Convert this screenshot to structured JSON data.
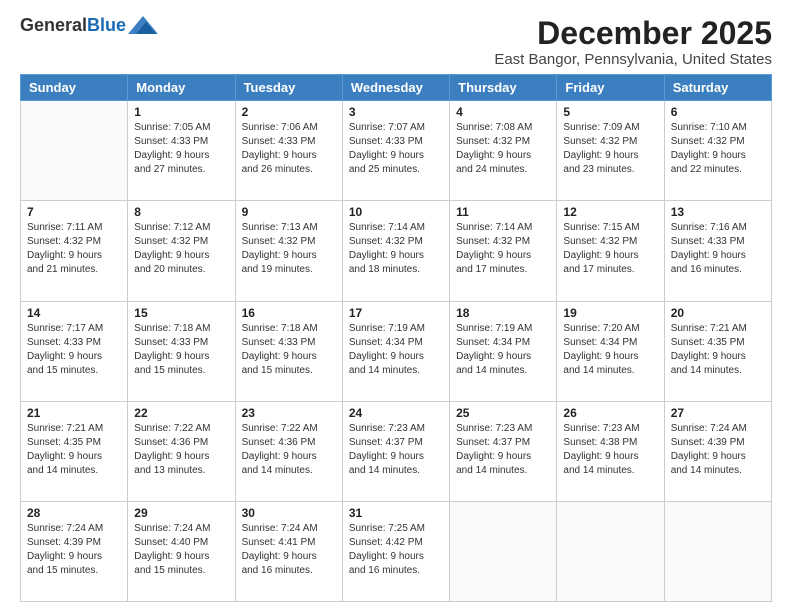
{
  "logo": {
    "general": "General",
    "blue": "Blue"
  },
  "title": "December 2025",
  "subtitle": "East Bangor, Pennsylvania, United States",
  "headers": [
    "Sunday",
    "Monday",
    "Tuesday",
    "Wednesday",
    "Thursday",
    "Friday",
    "Saturday"
  ],
  "weeks": [
    [
      {
        "day": "",
        "sunrise": "",
        "sunset": "",
        "daylight": ""
      },
      {
        "day": "1",
        "sunrise": "Sunrise: 7:05 AM",
        "sunset": "Sunset: 4:33 PM",
        "daylight": "Daylight: 9 hours and 27 minutes."
      },
      {
        "day": "2",
        "sunrise": "Sunrise: 7:06 AM",
        "sunset": "Sunset: 4:33 PM",
        "daylight": "Daylight: 9 hours and 26 minutes."
      },
      {
        "day": "3",
        "sunrise": "Sunrise: 7:07 AM",
        "sunset": "Sunset: 4:33 PM",
        "daylight": "Daylight: 9 hours and 25 minutes."
      },
      {
        "day": "4",
        "sunrise": "Sunrise: 7:08 AM",
        "sunset": "Sunset: 4:32 PM",
        "daylight": "Daylight: 9 hours and 24 minutes."
      },
      {
        "day": "5",
        "sunrise": "Sunrise: 7:09 AM",
        "sunset": "Sunset: 4:32 PM",
        "daylight": "Daylight: 9 hours and 23 minutes."
      },
      {
        "day": "6",
        "sunrise": "Sunrise: 7:10 AM",
        "sunset": "Sunset: 4:32 PM",
        "daylight": "Daylight: 9 hours and 22 minutes."
      }
    ],
    [
      {
        "day": "7",
        "sunrise": "Sunrise: 7:11 AM",
        "sunset": "Sunset: 4:32 PM",
        "daylight": "Daylight: 9 hours and 21 minutes."
      },
      {
        "day": "8",
        "sunrise": "Sunrise: 7:12 AM",
        "sunset": "Sunset: 4:32 PM",
        "daylight": "Daylight: 9 hours and 20 minutes."
      },
      {
        "day": "9",
        "sunrise": "Sunrise: 7:13 AM",
        "sunset": "Sunset: 4:32 PM",
        "daylight": "Daylight: 9 hours and 19 minutes."
      },
      {
        "day": "10",
        "sunrise": "Sunrise: 7:14 AM",
        "sunset": "Sunset: 4:32 PM",
        "daylight": "Daylight: 9 hours and 18 minutes."
      },
      {
        "day": "11",
        "sunrise": "Sunrise: 7:14 AM",
        "sunset": "Sunset: 4:32 PM",
        "daylight": "Daylight: 9 hours and 17 minutes."
      },
      {
        "day": "12",
        "sunrise": "Sunrise: 7:15 AM",
        "sunset": "Sunset: 4:32 PM",
        "daylight": "Daylight: 9 hours and 17 minutes."
      },
      {
        "day": "13",
        "sunrise": "Sunrise: 7:16 AM",
        "sunset": "Sunset: 4:33 PM",
        "daylight": "Daylight: 9 hours and 16 minutes."
      }
    ],
    [
      {
        "day": "14",
        "sunrise": "Sunrise: 7:17 AM",
        "sunset": "Sunset: 4:33 PM",
        "daylight": "Daylight: 9 hours and 15 minutes."
      },
      {
        "day": "15",
        "sunrise": "Sunrise: 7:18 AM",
        "sunset": "Sunset: 4:33 PM",
        "daylight": "Daylight: 9 hours and 15 minutes."
      },
      {
        "day": "16",
        "sunrise": "Sunrise: 7:18 AM",
        "sunset": "Sunset: 4:33 PM",
        "daylight": "Daylight: 9 hours and 15 minutes."
      },
      {
        "day": "17",
        "sunrise": "Sunrise: 7:19 AM",
        "sunset": "Sunset: 4:34 PM",
        "daylight": "Daylight: 9 hours and 14 minutes."
      },
      {
        "day": "18",
        "sunrise": "Sunrise: 7:19 AM",
        "sunset": "Sunset: 4:34 PM",
        "daylight": "Daylight: 9 hours and 14 minutes."
      },
      {
        "day": "19",
        "sunrise": "Sunrise: 7:20 AM",
        "sunset": "Sunset: 4:34 PM",
        "daylight": "Daylight: 9 hours and 14 minutes."
      },
      {
        "day": "20",
        "sunrise": "Sunrise: 7:21 AM",
        "sunset": "Sunset: 4:35 PM",
        "daylight": "Daylight: 9 hours and 14 minutes."
      }
    ],
    [
      {
        "day": "21",
        "sunrise": "Sunrise: 7:21 AM",
        "sunset": "Sunset: 4:35 PM",
        "daylight": "Daylight: 9 hours and 14 minutes."
      },
      {
        "day": "22",
        "sunrise": "Sunrise: 7:22 AM",
        "sunset": "Sunset: 4:36 PM",
        "daylight": "Daylight: 9 hours and 13 minutes."
      },
      {
        "day": "23",
        "sunrise": "Sunrise: 7:22 AM",
        "sunset": "Sunset: 4:36 PM",
        "daylight": "Daylight: 9 hours and 14 minutes."
      },
      {
        "day": "24",
        "sunrise": "Sunrise: 7:23 AM",
        "sunset": "Sunset: 4:37 PM",
        "daylight": "Daylight: 9 hours and 14 minutes."
      },
      {
        "day": "25",
        "sunrise": "Sunrise: 7:23 AM",
        "sunset": "Sunset: 4:37 PM",
        "daylight": "Daylight: 9 hours and 14 minutes."
      },
      {
        "day": "26",
        "sunrise": "Sunrise: 7:23 AM",
        "sunset": "Sunset: 4:38 PM",
        "daylight": "Daylight: 9 hours and 14 minutes."
      },
      {
        "day": "27",
        "sunrise": "Sunrise: 7:24 AM",
        "sunset": "Sunset: 4:39 PM",
        "daylight": "Daylight: 9 hours and 14 minutes."
      }
    ],
    [
      {
        "day": "28",
        "sunrise": "Sunrise: 7:24 AM",
        "sunset": "Sunset: 4:39 PM",
        "daylight": "Daylight: 9 hours and 15 minutes."
      },
      {
        "day": "29",
        "sunrise": "Sunrise: 7:24 AM",
        "sunset": "Sunset: 4:40 PM",
        "daylight": "Daylight: 9 hours and 15 minutes."
      },
      {
        "day": "30",
        "sunrise": "Sunrise: 7:24 AM",
        "sunset": "Sunset: 4:41 PM",
        "daylight": "Daylight: 9 hours and 16 minutes."
      },
      {
        "day": "31",
        "sunrise": "Sunrise: 7:25 AM",
        "sunset": "Sunset: 4:42 PM",
        "daylight": "Daylight: 9 hours and 16 minutes."
      },
      {
        "day": "",
        "sunrise": "",
        "sunset": "",
        "daylight": ""
      },
      {
        "day": "",
        "sunrise": "",
        "sunset": "",
        "daylight": ""
      },
      {
        "day": "",
        "sunrise": "",
        "sunset": "",
        "daylight": ""
      }
    ]
  ]
}
